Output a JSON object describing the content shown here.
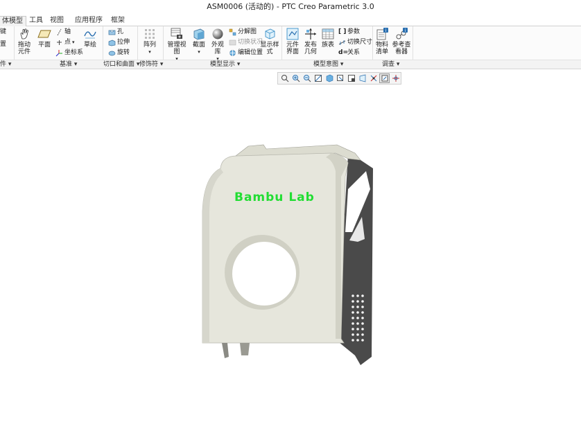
{
  "window": {
    "title": "ASM0006 (活动的) - PTC Creo Parametric 3.0"
  },
  "tabs": [
    {
      "label": "体模型",
      "active": true
    },
    {
      "label": "工具",
      "active": false
    },
    {
      "label": "视图",
      "active": false
    },
    {
      "label": "应用程序",
      "active": false
    },
    {
      "label": "框架",
      "active": false
    }
  ],
  "ribbon": {
    "left_partial": {
      "line1": "键",
      "line2": "置"
    },
    "drag": {
      "line1": "拖动",
      "line2": "元件"
    },
    "plane": "平面",
    "axis": "轴",
    "point": "点",
    "csys": "坐标系",
    "sketch": "草绘",
    "hole": "孔",
    "extrude": "拉伸",
    "revolve": "旋转",
    "pattern": "阵列",
    "manage_views": "管理视图",
    "section": "截面",
    "appearance": "外观库",
    "explode": "分解图",
    "toggle_status": "切换状况",
    "edit_position": "编辑位置",
    "display_style": {
      "line1": "显示样",
      "line2": "式"
    },
    "component_interface": {
      "line1": "元件",
      "line2": "界面"
    },
    "publish_geometry": {
      "line1": "发布",
      "line2": "几何"
    },
    "family_table": "族表",
    "parameters": "参数",
    "toggle_dimensions": "切换尺寸",
    "relations": "关系",
    "bom": {
      "line1": "物料",
      "line2": "清单"
    },
    "reference_viewer": {
      "line1": "参考查",
      "line2": "看器"
    }
  },
  "groups": {
    "g0": "件",
    "datum": "基准",
    "cut_surface": "切口和曲面",
    "modifiers": "修饰符",
    "model_display": "模型显示",
    "model_intent": "模型意图",
    "investigate": "调查"
  },
  "model": {
    "logo_text": "Bambu Lab"
  },
  "colors": {
    "logo_green": "#22dd33",
    "shell": "#e6e6dc",
    "side": "#4a4a4a"
  }
}
